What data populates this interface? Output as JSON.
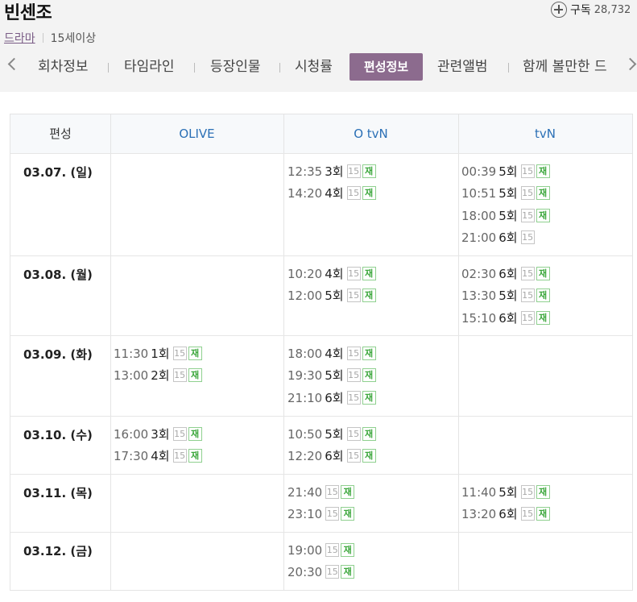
{
  "header": {
    "title": "빈센조",
    "subscribe_label": "구독",
    "subscribe_count": "28,732",
    "genre": "드라마",
    "rating": "15세이상"
  },
  "tabs": [
    "회차정보",
    "타임라인",
    "등장인물",
    "시청률",
    "편성정보",
    "관련앨범",
    "함께 볼만한 드"
  ],
  "active_tab": "편성정보",
  "schedule": {
    "header_label": "편성",
    "channels": [
      "OLIVE",
      "O tvN",
      "tvN"
    ],
    "badges": {
      "age": "15",
      "rerun": "재"
    },
    "rows": [
      {
        "date": "03.07. (일)",
        "OLIVE": [],
        "OtvN": [
          {
            "time": "12:35",
            "ep": "3회",
            "rerun": true
          },
          {
            "time": "14:20",
            "ep": "4회",
            "rerun": true
          }
        ],
        "tvN": [
          {
            "time": "00:39",
            "ep": "5회",
            "rerun": true
          },
          {
            "time": "10:51",
            "ep": "5회",
            "rerun": true
          },
          {
            "time": "18:00",
            "ep": "5회",
            "rerun": true
          },
          {
            "time": "21:00",
            "ep": "6회",
            "rerun": false
          }
        ]
      },
      {
        "date": "03.08. (월)",
        "OLIVE": [],
        "OtvN": [
          {
            "time": "10:20",
            "ep": "4회",
            "rerun": true
          },
          {
            "time": "12:00",
            "ep": "5회",
            "rerun": true
          }
        ],
        "tvN": [
          {
            "time": "02:30",
            "ep": "6회",
            "rerun": true
          },
          {
            "time": "13:30",
            "ep": "5회",
            "rerun": true
          },
          {
            "time": "15:10",
            "ep": "6회",
            "rerun": true
          }
        ]
      },
      {
        "date": "03.09. (화)",
        "OLIVE": [
          {
            "time": "11:30",
            "ep": "1회",
            "rerun": true
          },
          {
            "time": "13:00",
            "ep": "2회",
            "rerun": true
          }
        ],
        "OtvN": [
          {
            "time": "18:00",
            "ep": "4회",
            "rerun": true
          },
          {
            "time": "19:30",
            "ep": "5회",
            "rerun": true
          },
          {
            "time": "21:10",
            "ep": "6회",
            "rerun": true
          }
        ],
        "tvN": []
      },
      {
        "date": "03.10. (수)",
        "OLIVE": [
          {
            "time": "16:00",
            "ep": "3회",
            "rerun": true
          },
          {
            "time": "17:30",
            "ep": "4회",
            "rerun": true
          }
        ],
        "OtvN": [
          {
            "time": "10:50",
            "ep": "5회",
            "rerun": true
          },
          {
            "time": "12:20",
            "ep": "6회",
            "rerun": true
          }
        ],
        "tvN": []
      },
      {
        "date": "03.11. (목)",
        "OLIVE": [],
        "OtvN": [
          {
            "time": "21:40",
            "ep": "",
            "rerun": true
          },
          {
            "time": "23:10",
            "ep": "",
            "rerun": true
          }
        ],
        "tvN": [
          {
            "time": "11:40",
            "ep": "5회",
            "rerun": true
          },
          {
            "time": "13:20",
            "ep": "6회",
            "rerun": true
          }
        ]
      },
      {
        "date": "03.12. (금)",
        "OLIVE": [],
        "OtvN": [
          {
            "time": "19:00",
            "ep": "",
            "rerun": true
          },
          {
            "time": "20:30",
            "ep": "",
            "rerun": true
          }
        ],
        "tvN": []
      }
    ]
  }
}
